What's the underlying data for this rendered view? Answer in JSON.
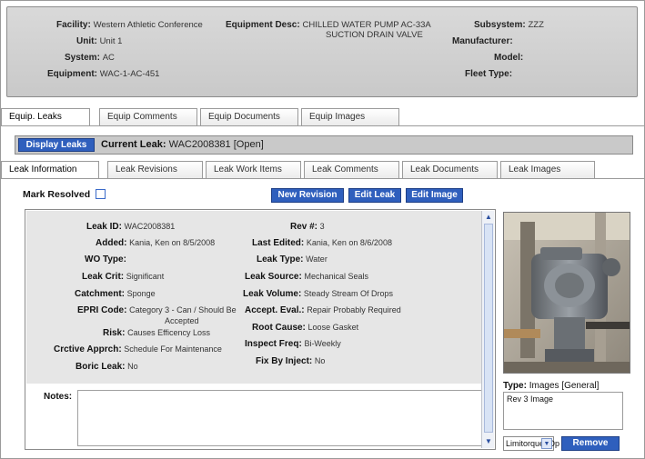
{
  "header": {
    "facility_label": "Facility:",
    "facility_value": "Western Athletic Conference",
    "unit_label": "Unit:",
    "unit_value": "Unit 1",
    "system_label": "System:",
    "system_value": "AC",
    "equipment_label": "Equipment:",
    "equipment_value": "WAC-1-AC-451",
    "equip_desc_label": "Equipment Desc:",
    "equip_desc_line1": "CHILLED WATER PUMP AC-33A",
    "equip_desc_line2": "SUCTION DRAIN VALVE",
    "subsystem_label": "Subsystem:",
    "subsystem_value": "ZZZ",
    "manufacturer_label": "Manufacturer:",
    "manufacturer_value": "",
    "model_label": "Model:",
    "model_value": "",
    "fleet_type_label": "Fleet Type:",
    "fleet_type_value": ""
  },
  "main_tabs": [
    {
      "label": "Equip. Leaks"
    },
    {
      "label": "Equip Comments"
    },
    {
      "label": "Equip Documents"
    },
    {
      "label": "Equip Images"
    }
  ],
  "leak_bar": {
    "display_button": "Display Leaks",
    "current_label": "Current Leak:",
    "current_value": "WAC2008381 [Open]"
  },
  "sub_tabs": [
    {
      "label": "Leak Information"
    },
    {
      "label": "Leak Revisions"
    },
    {
      "label": "Leak Work Items"
    },
    {
      "label": "Leak Comments"
    },
    {
      "label": "Leak Documents"
    },
    {
      "label": "Leak Images"
    }
  ],
  "actions": {
    "mark_resolved": "Mark Resolved",
    "new_revision": "New Revision",
    "edit_leak": "Edit Leak",
    "edit_image": "Edit Image"
  },
  "leak_left": {
    "leak_id_label": "Leak ID:",
    "leak_id_value": "WAC2008381",
    "added_label": "Added:",
    "added_value": "Kania, Ken on 8/5/2008",
    "wo_type_label": "WO Type:",
    "wo_type_value": "",
    "leak_crit_label": "Leak Crit:",
    "leak_crit_value": "Significant",
    "catchment_label": "Catchment:",
    "catchment_value": "Sponge",
    "epri_label": "EPRI Code:",
    "epri_value_line1": "Category 3 - Can / Should Be",
    "epri_value_line2": "Accepted",
    "risk_label": "Risk:",
    "risk_value": "Causes Efficency Loss",
    "crctive_label": "Crctive Apprch:",
    "crctive_value": "Schedule For Maintenance",
    "boric_label": "Boric Leak:",
    "boric_value": "No"
  },
  "leak_right": {
    "rev_label": "Rev #:",
    "rev_value": "3",
    "last_edited_label": "Last Edited:",
    "last_edited_value": "Kania, Ken on 8/6/2008",
    "leak_type_label": "Leak Type:",
    "leak_type_value": "Water",
    "leak_source_label": "Leak Source:",
    "leak_source_value": "Mechanical Seals",
    "leak_volume_label": "Leak Volume:",
    "leak_volume_value": "Steady Stream Of Drops",
    "accept_label": "Accept. Eval.:",
    "accept_value": "Repair Probably Required",
    "root_cause_label": "Root Cause:",
    "root_cause_value": "Loose Gasket",
    "inspect_label": "Inspect Freq:",
    "inspect_value": "Bi-Weekly",
    "fix_label": "Fix By Inject:",
    "fix_value": "No"
  },
  "notes": {
    "label": "Notes:",
    "value": ""
  },
  "image_panel": {
    "type_label": "Type:",
    "type_value": "Images [General]",
    "note_value": "Rev 3 Image",
    "select_value": "Limitorque_Op",
    "remove_button": "Remove"
  },
  "colors": {
    "accent_blue": "#2f5fbd",
    "panel_gray": "#e6e6e6",
    "header_gray": "#d0d0d0"
  }
}
